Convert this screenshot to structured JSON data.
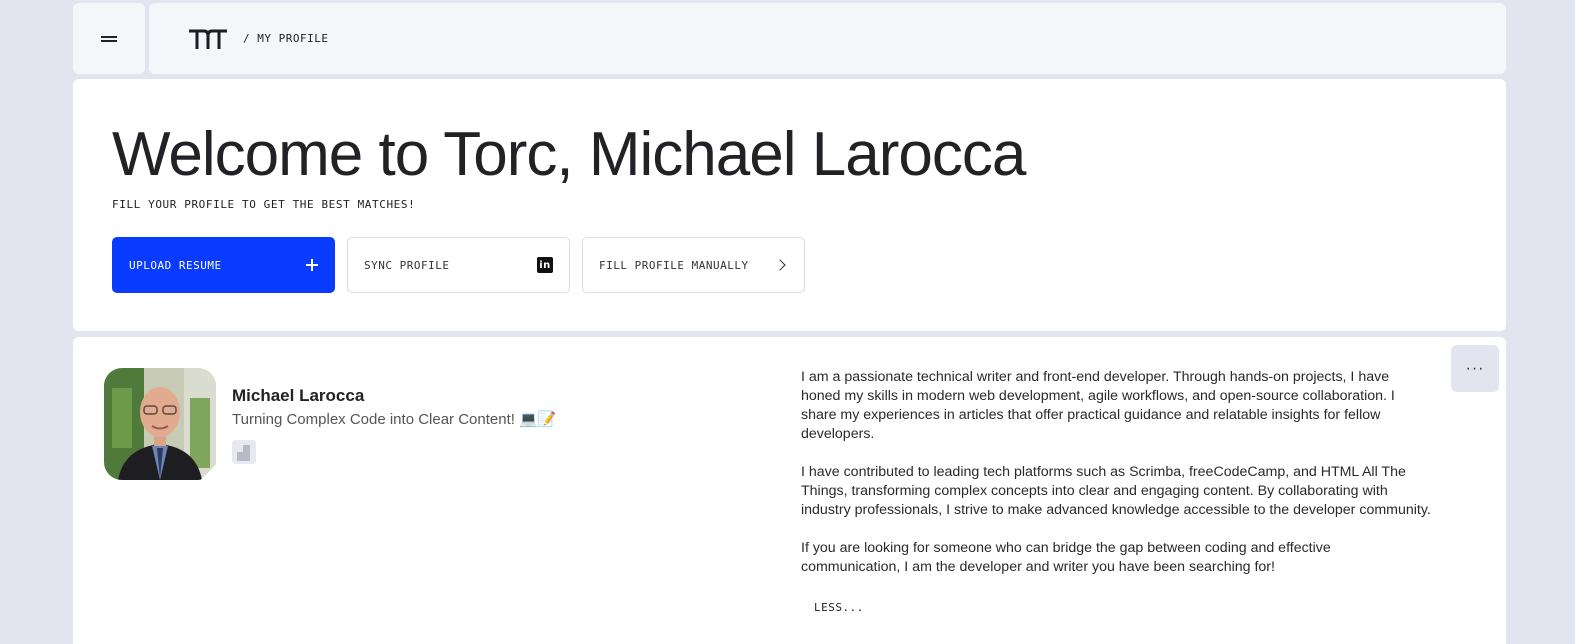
{
  "header": {
    "breadcrumb": "/ MY PROFILE",
    "menu_icon": "hamburger-icon",
    "logo_icon": "torc-logo"
  },
  "welcome": {
    "title": "Welcome to Torc, Michael Larocca",
    "subtitle": "FILL YOUR PROFILE TO GET THE BEST MATCHES!",
    "actions": [
      {
        "label": "UPLOAD RESUME",
        "icon": "plus-icon"
      },
      {
        "label": "SYNC PROFILE",
        "icon": "linkedin-icon"
      },
      {
        "label": "FILL PROFILE MANUALLY",
        "icon": "chevron-right-icon"
      }
    ]
  },
  "profile": {
    "name": "Michael Larocca",
    "tagline": "Turning Complex Code into Clear Content! 💻📝",
    "more_icon": "ellipsis-icon",
    "bio": [
      "I am a passionate technical writer and front-end developer. Through hands-on projects, I have honed my skills in modern web development, agile workflows, and open-source collaboration. I share my experiences in articles that offer practical guidance and relatable insights for fellow developers.",
      "I have contributed to leading tech platforms such as Scrimba, freeCodeCamp, and HTML All The Things, transforming complex concepts into clear and engaging content. By collaborating with industry professionals, I strive to make advanced knowledge accessible to the developer community.",
      "If you are looking for someone who can bridge the gap between coding and effective communication, I am the developer and writer you have been searching for!"
    ],
    "toggle_label": "LESS..."
  },
  "colors": {
    "accent": "#0a3cff",
    "background": "#e2e4ef",
    "card": "#ffffff"
  }
}
